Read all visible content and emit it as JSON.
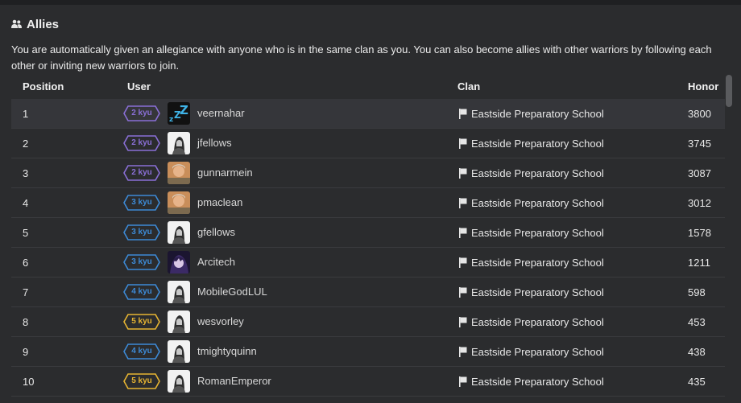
{
  "header": {
    "title": "Allies",
    "icon": "users-icon"
  },
  "description": "You are automatically given an allegiance with anyone who is in the same clan as you. You can also become allies with other warriors by following each other or inviting new warriors to join.",
  "columns": {
    "position": "Position",
    "user": "User",
    "clan": "Clan",
    "honor": "Honor"
  },
  "colors": {
    "rank_2kyu": "#8a6fd6",
    "rank_3kyu": "#3d8ad6",
    "rank_4kyu": "#3d8ad6",
    "rank_5kyu": "#e6b432"
  },
  "rows": [
    {
      "position": "1",
      "rank": "2 kyu",
      "rank_color": "#8a6fd6",
      "avatar": "zzz-avatar",
      "user": "veernahar",
      "clan": "Eastside Preparatory School",
      "honor": "3800"
    },
    {
      "position": "2",
      "rank": "2 kyu",
      "rank_color": "#8a6fd6",
      "avatar": "warrior-avatar",
      "user": "jfellows",
      "clan": "Eastside Preparatory School",
      "honor": "3745"
    },
    {
      "position": "3",
      "rank": "2 kyu",
      "rank_color": "#8a6fd6",
      "avatar": "photo-avatar",
      "user": "gunnarmein",
      "clan": "Eastside Preparatory School",
      "honor": "3087"
    },
    {
      "position": "4",
      "rank": "3 kyu",
      "rank_color": "#3d8ad6",
      "avatar": "photo-avatar",
      "user": "pmaclean",
      "clan": "Eastside Preparatory School",
      "honor": "3012"
    },
    {
      "position": "5",
      "rank": "3 kyu",
      "rank_color": "#3d8ad6",
      "avatar": "warrior-avatar",
      "user": "gfellows",
      "clan": "Eastside Preparatory School",
      "honor": "1578"
    },
    {
      "position": "6",
      "rank": "3 kyu",
      "rank_color": "#3d8ad6",
      "avatar": "anime-avatar",
      "user": "Arcitech",
      "clan": "Eastside Preparatory School",
      "honor": "1211"
    },
    {
      "position": "7",
      "rank": "4 kyu",
      "rank_color": "#3d8ad6",
      "avatar": "warrior-avatar",
      "user": "MobileGodLUL",
      "clan": "Eastside Preparatory School",
      "honor": "598"
    },
    {
      "position": "8",
      "rank": "5 kyu",
      "rank_color": "#e6b432",
      "avatar": "warrior-avatar",
      "user": "wesvorley",
      "clan": "Eastside Preparatory School",
      "honor": "453"
    },
    {
      "position": "9",
      "rank": "4 kyu",
      "rank_color": "#3d8ad6",
      "avatar": "warrior-avatar",
      "user": "tmightyquinn",
      "clan": "Eastside Preparatory School",
      "honor": "438"
    },
    {
      "position": "10",
      "rank": "5 kyu",
      "rank_color": "#e6b432",
      "avatar": "warrior-avatar",
      "user": "RomanEmperor",
      "clan": "Eastside Preparatory School",
      "honor": "435"
    }
  ]
}
